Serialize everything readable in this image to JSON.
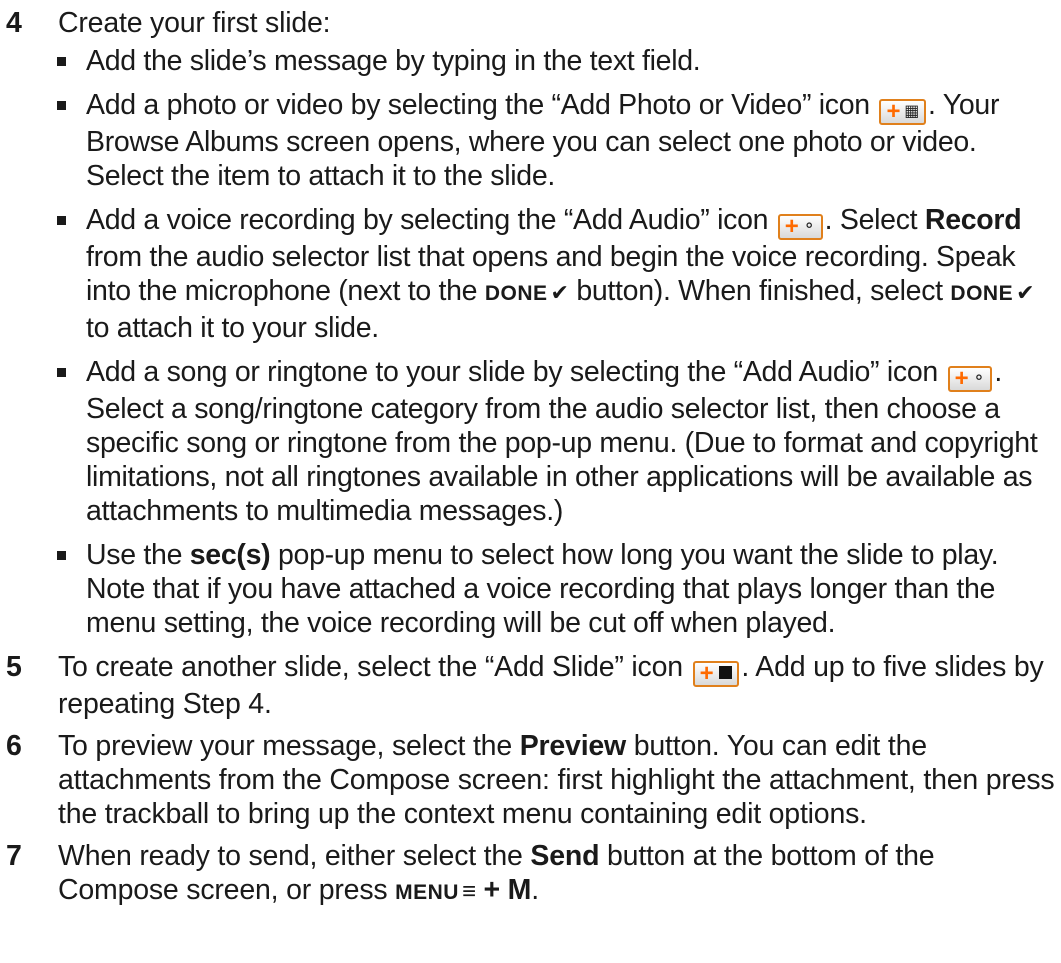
{
  "step4": {
    "number": "4",
    "title": "Create your first slide:",
    "bullets": [
      {
        "id": "message",
        "text": "Add the slide’s message by typing in the text field."
      },
      {
        "id": "photo",
        "part1": "Add a photo or video by selecting the “Add Photo or Video” icon",
        "part2": ". Your Browse Albums screen opens, where you can select one photo or video. Select the item to attach it to the slide."
      },
      {
        "id": "voice",
        "part1": "Add a voice recording by selecting the “Add Audio” icon",
        "part2": ". Select",
        "record_label": "Record",
        "part3": "from the audio selector list that opens and begin the voice recording. Speak into the microphone (next to the",
        "done_label": "DONE",
        "part4": "button). When finished, select",
        "done_label_2": "DONE",
        "part5": "to attach it to your slide."
      },
      {
        "id": "song",
        "part1": "Add a song or ringtone to your slide by selecting the “Add Audio” icon",
        "part2": ". Select a song/ringtone category from the audio selector list, then choose a specific song or ringtone from the pop-up menu. (Due to format and copyright limitations, not all ringtones available in other applications will be available as attachments to multimedia messages.)"
      },
      {
        "id": "duration",
        "part1": "Use the",
        "secs_label": "sec(s)",
        "part2": "pop-up menu to select how long you want the slide to play. Note that if you have attached a voice recording that plays longer than the menu setting, the voice recording will be cut off when played."
      }
    ]
  },
  "step5": {
    "number": "5",
    "part1": "To create another slide, select the “Add Slide” icon",
    "part2": ". Add up to five slides by repeating Step 4."
  },
  "step6": {
    "number": "6",
    "part1": "To preview your message, select the",
    "preview_label": "Preview",
    "part2": "button. You can edit the attachments from the Compose screen: first highlight the attachment, then press the trackball to bring up the context menu containing edit options."
  },
  "step7": {
    "number": "7",
    "part1": "When ready to send, either select the",
    "send_label": "Send",
    "part2": "button at the bottom of the Compose screen, or press",
    "menu_label": "MENU",
    "plus_m": "+ M",
    "part3": "."
  },
  "icons": {
    "add_photo_video": "add-photo-video-icon",
    "add_audio": "add-audio-icon",
    "add_slide": "add-slide-icon",
    "check": "checkmark-icon",
    "menu": "menu-icon"
  },
  "colors": {
    "accent": "#ff6a00",
    "icon_border": "#e0801c",
    "text": "#1a1a1a"
  }
}
